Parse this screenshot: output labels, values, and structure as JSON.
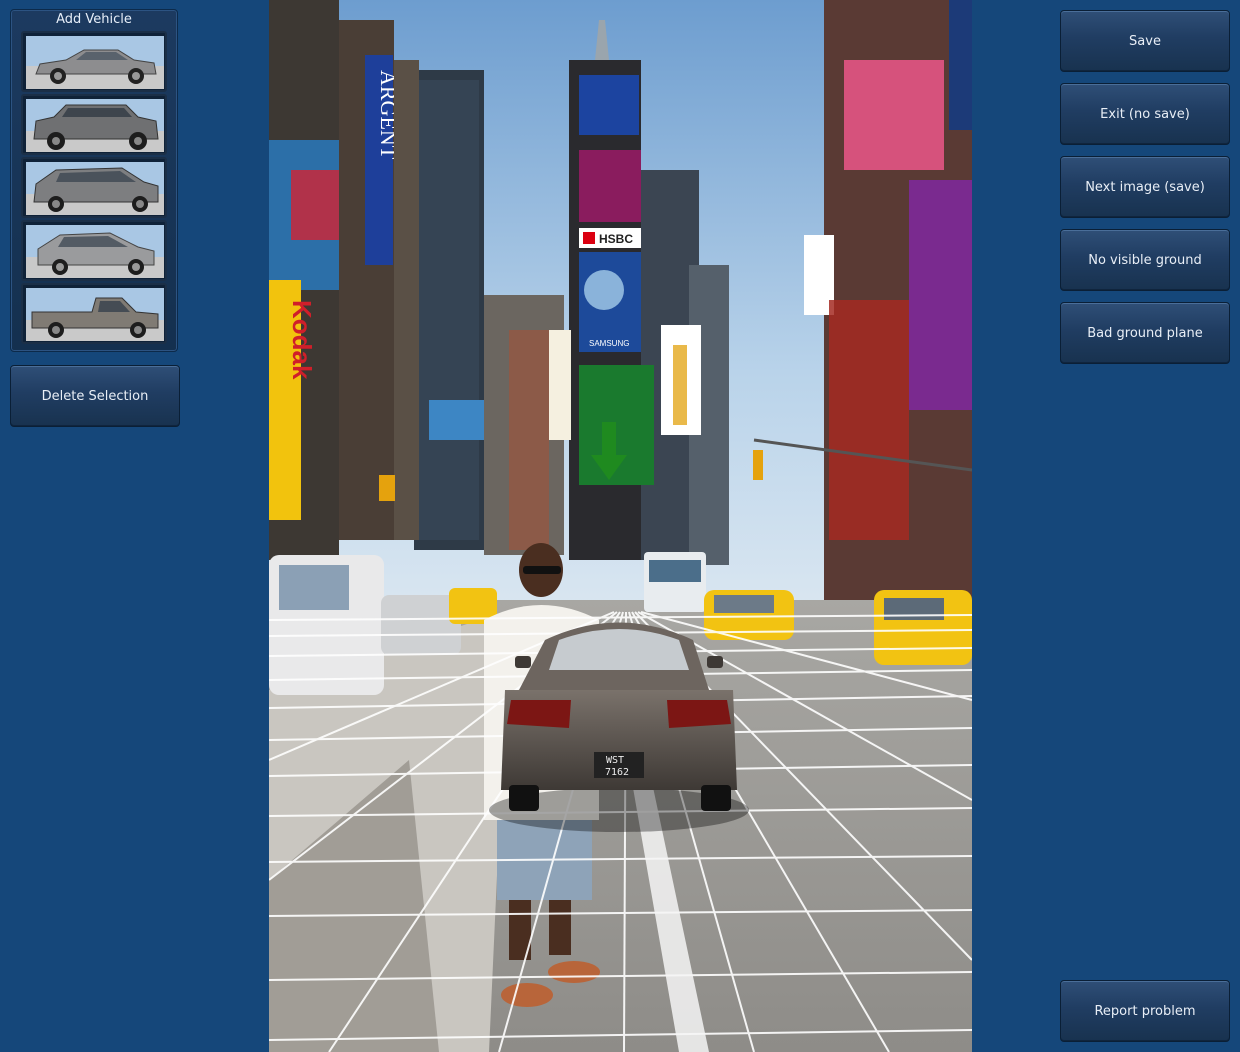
{
  "left_panel": {
    "title": "Add Vehicle",
    "vehicles": [
      {
        "icon": "sedan-icon",
        "body_color": "#8d8d8f"
      },
      {
        "icon": "suv-icon",
        "body_color": "#6f7072"
      },
      {
        "icon": "minivan-icon",
        "body_color": "#7d7e80"
      },
      {
        "icon": "hatchback-icon",
        "body_color": "#9a9b9d"
      },
      {
        "icon": "pickup-truck-icon",
        "body_color": "#807b74"
      }
    ],
    "delete_label": "Delete Selection"
  },
  "right_panel": {
    "save_label": "Save",
    "exit_label": "Exit (no save)",
    "next_label": "Next image (save)",
    "no_ground_label": "No visible ground",
    "bad_plane_label": "Bad ground plane",
    "report_label": "Report problem"
  },
  "scene": {
    "signs": {
      "argent": "ARGENT",
      "kodak": "Kodak",
      "hsbc": "HSBC",
      "samsung": "SAMSUNG"
    },
    "inserted_car_plate_line1": "WST",
    "inserted_car_plate_line2": "7162",
    "colors": {
      "sky": "#a9c8e6",
      "road": "#9c9a96",
      "grid": "#ffffff",
      "taxi": "#f2c312",
      "marker_arrow": "#1f8a1f",
      "inserted_car": "#5a534d"
    }
  }
}
